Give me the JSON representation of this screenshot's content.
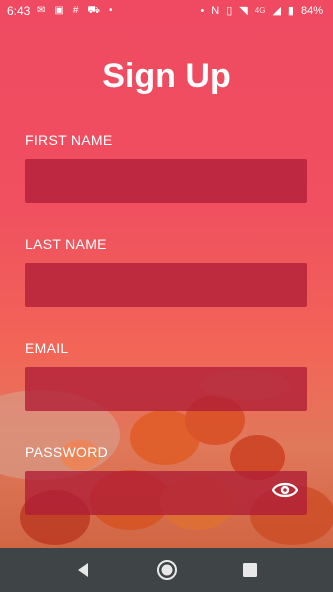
{
  "status_bar": {
    "time": "6:43",
    "network": "4G",
    "battery": "84%",
    "icons": [
      "mail-icon",
      "image-icon",
      "slack-icon",
      "bed-icon",
      "dot-icon",
      "nfc-icon",
      "vibrate-icon",
      "wifi-icon",
      "signal-icon",
      "battery-icon"
    ]
  },
  "form": {
    "title": "Sign Up",
    "fields": [
      {
        "label": "FIRST NAME",
        "value": ""
      },
      {
        "label": "LAST NAME",
        "value": ""
      },
      {
        "label": "EMAIL",
        "value": ""
      },
      {
        "label": "PASSWORD",
        "value": ""
      }
    ]
  },
  "colors": {
    "background_top": "#ef4a62",
    "field_fill": "#b01e37",
    "text": "#ffffff",
    "nav_bar": "#3f4447"
  },
  "nav_bar": {
    "buttons": [
      "back-icon",
      "home-icon",
      "recents-icon"
    ]
  }
}
